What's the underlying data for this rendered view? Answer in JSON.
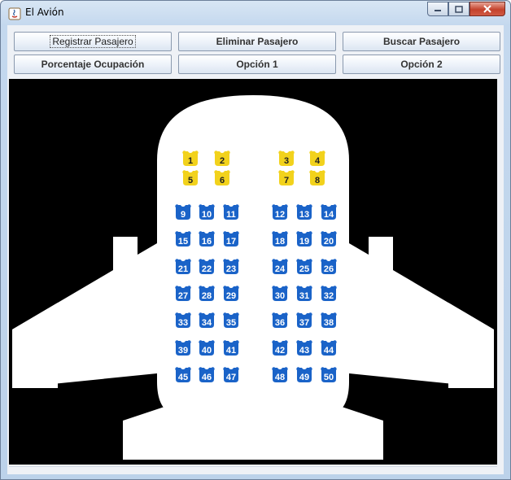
{
  "window": {
    "title": "El Avión"
  },
  "buttons": [
    {
      "id": "registrar",
      "label": "Registrar Pasajero"
    },
    {
      "id": "eliminar",
      "label": "Eliminar Pasajero"
    },
    {
      "id": "buscar",
      "label": "Buscar Pasajero"
    },
    {
      "id": "porcentaje",
      "label": "Porcentaje Ocupación"
    },
    {
      "id": "opcion1",
      "label": "Opción 1"
    },
    {
      "id": "opcion2",
      "label": "Opción 2"
    }
  ],
  "seats": {
    "first_class": [
      "1",
      "2",
      "3",
      "4",
      "5",
      "6",
      "7",
      "8"
    ],
    "economy": [
      "9",
      "10",
      "11",
      "12",
      "13",
      "14",
      "15",
      "16",
      "17",
      "18",
      "19",
      "20",
      "21",
      "22",
      "23",
      "24",
      "25",
      "26",
      "27",
      "28",
      "29",
      "30",
      "31",
      "32",
      "33",
      "34",
      "35",
      "36",
      "37",
      "38",
      "39",
      "40",
      "41",
      "42",
      "43",
      "44",
      "45",
      "46",
      "47",
      "48",
      "49",
      "50"
    ]
  },
  "colors": {
    "first_class_seat": "#f2d21c",
    "economy_seat": "#1a63c8",
    "canvas": "#000000",
    "plane": "#ffffff"
  }
}
